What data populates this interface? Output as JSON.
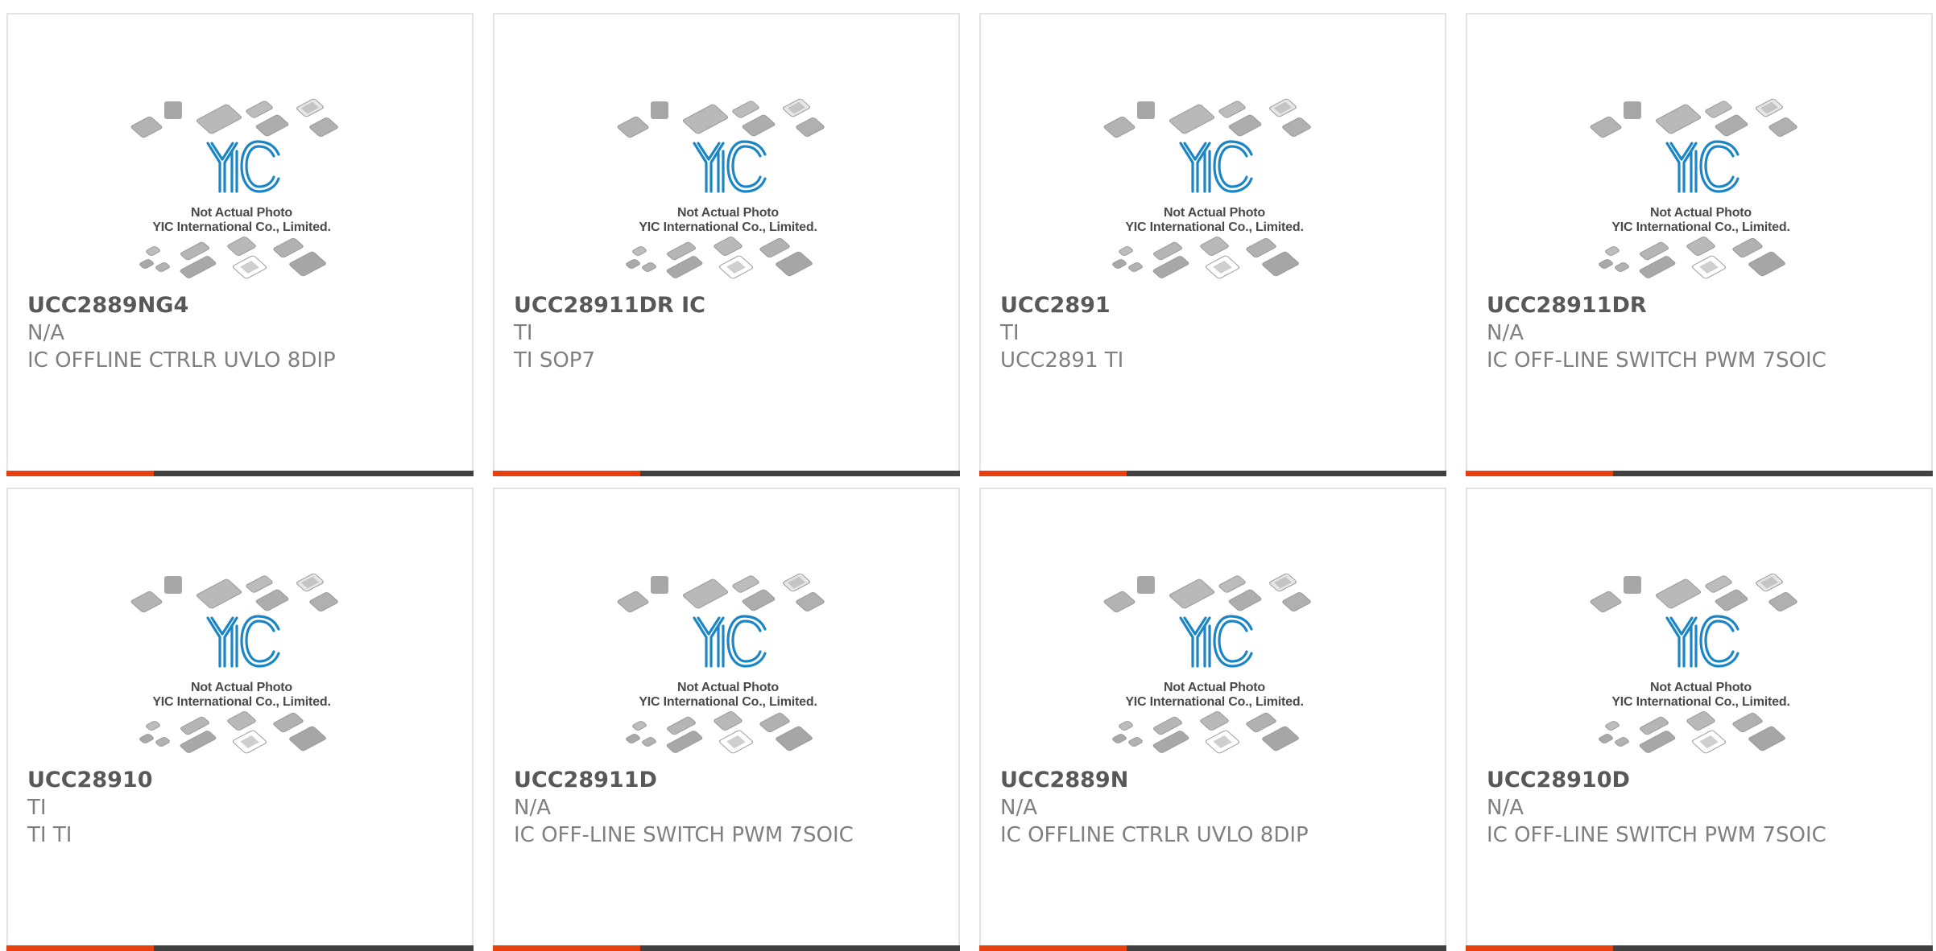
{
  "thumbnail": {
    "caption_line1": "Not Actual Photo",
    "caption_line2": "YIC International Co., Limited.",
    "logo_text": "YIC",
    "logo_color": "#1b86c6"
  },
  "colors": {
    "accent": "#e8410f",
    "bar": "#414141",
    "title": "#585858",
    "text": "#808080",
    "border": "#e3e3e3"
  },
  "products": [
    {
      "part_number": "UCC2889NG4",
      "manufacturer": "N/A",
      "description": "IC OFFLINE CTRLR UVLO 8DIP"
    },
    {
      "part_number": "UCC28911DR IC",
      "manufacturer": "TI",
      "description": "TI SOP7"
    },
    {
      "part_number": "UCC2891",
      "manufacturer": "TI",
      "description": "UCC2891 TI"
    },
    {
      "part_number": "UCC28911DR",
      "manufacturer": "N/A",
      "description": "IC OFF-LINE SWITCH PWM 7SOIC"
    },
    {
      "part_number": "UCC28910",
      "manufacturer": "TI",
      "description": "TI TI"
    },
    {
      "part_number": "UCC28911D",
      "manufacturer": "N/A",
      "description": "IC OFF-LINE SWITCH PWM 7SOIC"
    },
    {
      "part_number": "UCC2889N",
      "manufacturer": "N/A",
      "description": "IC OFFLINE CTRLR UVLO 8DIP"
    },
    {
      "part_number": "UCC28910D",
      "manufacturer": "N/A",
      "description": "IC OFF-LINE SWITCH PWM 7SOIC"
    }
  ]
}
